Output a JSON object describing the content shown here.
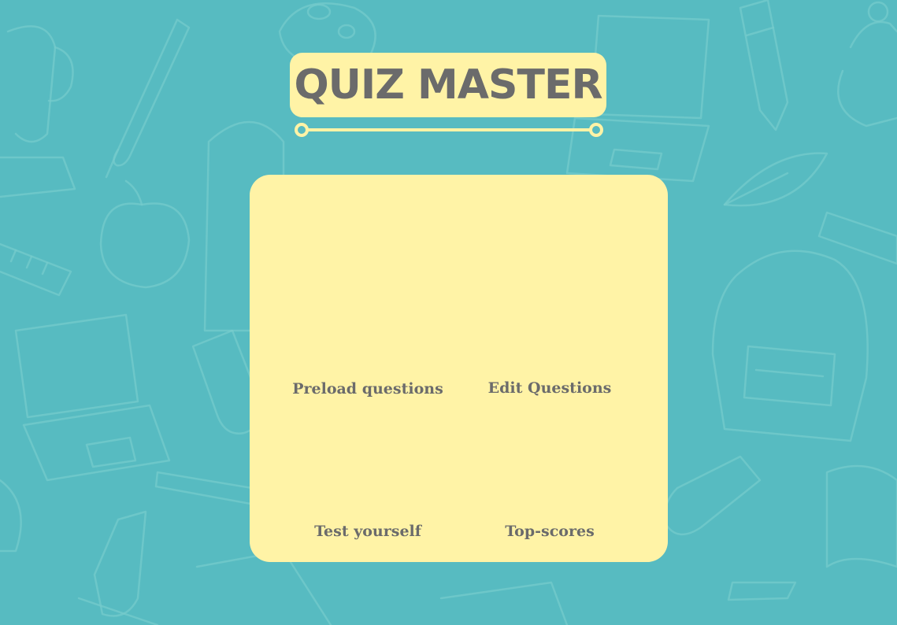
{
  "app": {
    "title": "QUIZ MASTER"
  },
  "menu": {
    "items": [
      {
        "id": "preload",
        "label": "Preload questions"
      },
      {
        "id": "edit",
        "label": "Edit Questions"
      },
      {
        "id": "test",
        "label": "Test yourself"
      },
      {
        "id": "topscores",
        "label": "Top-scores"
      }
    ]
  },
  "colors": {
    "background": "#57bbc1",
    "doodle_stroke": "#7fd0cf",
    "panel": "#fff3a6",
    "text": "#6b6b6b"
  },
  "decor": {
    "background_icons": [
      "trophy-icon",
      "paintbrush-icon",
      "artist-palette-icon",
      "laptop-icon",
      "pencil-icon",
      "teapot-icon",
      "backpack-icon",
      "apple-icon",
      "ruler-icon",
      "leaf-icon",
      "test-tube-icon",
      "microscope-icon",
      "pen-icon",
      "book-icon"
    ]
  }
}
